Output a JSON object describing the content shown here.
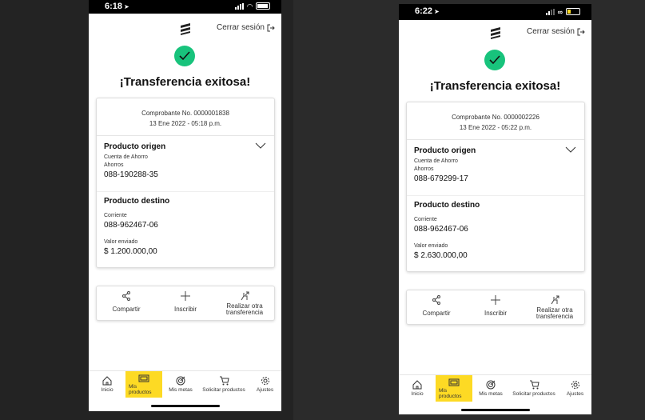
{
  "screens": [
    {
      "status_time": "6:18",
      "logout": "Cerrar sesión",
      "title": "¡Transferencia exitosa!",
      "receipt": "Comprobante No. 0000001838",
      "date": "13 Ene 2022 - 05:18 p.m.",
      "origin_title": "Producto origen",
      "origin_type": "Cuenta de Ahorro",
      "origin_subtype": "Ahorros",
      "origin_number": "088-190288-35",
      "dest_title": "Producto destino",
      "dest_type": "Corriente",
      "dest_number": "088-962467-06",
      "amount_label": "Valor enviado",
      "amount": "$ 1.200.000,00",
      "battery_level": 1.0
    },
    {
      "status_time": "6:22",
      "logout": "Cerrar sesión",
      "title": "¡Transferencia exitosa!",
      "receipt": "Comprobante No. 0000002226",
      "date": "13 Ene 2022 - 05:22 p.m.",
      "origin_title": "Producto origen",
      "origin_type": "Cuenta de Ahorro",
      "origin_subtype": "Ahorros",
      "origin_number": "088-679299-17",
      "dest_title": "Producto destino",
      "dest_type": "Corriente",
      "dest_number": "088-962467-06",
      "amount_label": "Valor enviado",
      "amount": "$ 2.630.000,00",
      "battery_level": 0.25
    }
  ],
  "actions": {
    "share": "Compartir",
    "enroll": "Inscribir",
    "again_line1": "Realizar otra",
    "again_line2": "transferencia"
  },
  "nav": {
    "home": "Inicio",
    "products": "Mis productos",
    "goals": "Mis metas",
    "request": "Solicitar productos",
    "settings": "Ajustes"
  },
  "colors": {
    "accent": "#fdda24",
    "success": "#18c37c",
    "battery_low": "#fdda24"
  }
}
